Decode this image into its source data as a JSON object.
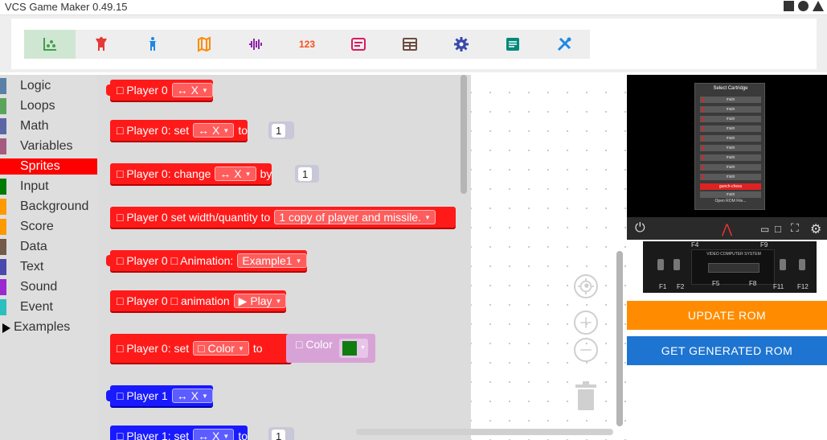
{
  "window": {
    "title": "VCS Game Maker 0.49.15"
  },
  "toolbar": {
    "sprites_label": "",
    "numbers_label": "123",
    "colors": {
      "sprites": "#43a04a",
      "player0": "#e53935",
      "player1": "#1e88e5",
      "playfield": "#fb8c00",
      "sound": "#8e24aa",
      "numbers": "#f4511e",
      "text": "#d81b60",
      "board": "#6d4c41",
      "settings": "#3949ab",
      "messages": "#00897b",
      "tools": "#1e88e5"
    }
  },
  "categories": [
    {
      "label": "Logic",
      "color": "#5b80a5"
    },
    {
      "label": "Loops",
      "color": "#5ba55b"
    },
    {
      "label": "Math",
      "color": "#5b67a5"
    },
    {
      "label": "Variables",
      "color": "#a55b80"
    },
    {
      "label": "Sprites",
      "color": "#ff0000"
    },
    {
      "label": "Input",
      "color": "#007a00"
    },
    {
      "label": "Background",
      "color": "#ff9900"
    },
    {
      "label": "Score",
      "color": "#ff9900"
    },
    {
      "label": "Data",
      "color": "#745a4a"
    },
    {
      "label": "Text",
      "color": "#4a4aad"
    },
    {
      "label": "Sound",
      "color": "#9a2ad0"
    },
    {
      "label": "Event",
      "color": "#2ac0c0"
    }
  ],
  "examples_label": "Examples",
  "blocks": {
    "b1": {
      "label": "□ Player 0",
      "dd": "↔ X"
    },
    "b2": {
      "label": "□ Player 0: set",
      "dd": "↔ X",
      "to": "to",
      "num": "1"
    },
    "b3": {
      "label": "□ Player 0: change",
      "dd": "↔ X",
      "by": "by",
      "num": "1"
    },
    "b4": {
      "label": "□ Player 0 set width/quantity to",
      "dd": "1 copy of player and missile."
    },
    "b5": {
      "label": "□ Player 0 □ Animation:",
      "dd": "Example1"
    },
    "b6": {
      "label": "□ Player 0 □ animation",
      "dd": "▶ Play"
    },
    "b7": {
      "label": "□ Player 0: set",
      "dd": "□ Color",
      "to": "to",
      "color_label": "□ Color",
      "swatch": "#0f7d0f"
    },
    "b8": {
      "label": "□ Player 1",
      "dd": "↔ X"
    },
    "b9": {
      "label": "□ Player 1: set",
      "dd": "↔ X",
      "to": "to",
      "num": "1"
    }
  },
  "emulator": {
    "select_title": "Select Cartridge",
    "cartridges": [
      "main",
      "main",
      "main",
      "main",
      "main",
      "main",
      "main",
      "main",
      "main",
      "gunch-chess",
      "main"
    ],
    "open_rom": "Open ROM File...",
    "keys": {
      "f1": "F1",
      "f2": "F2",
      "f4": "F4",
      "f5": "F5",
      "f8": "F8",
      "f9": "F9",
      "f11": "F11",
      "f12": "F12"
    },
    "vcs_label": "VIDEO COMPUTER SYSTEM"
  },
  "buttons": {
    "update": "UPDATE ROM",
    "generate": "GET GENERATED ROM"
  }
}
